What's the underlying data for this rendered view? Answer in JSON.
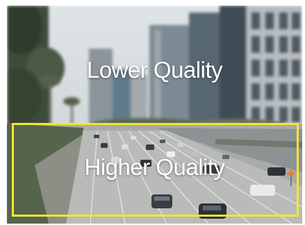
{
  "labels": {
    "top": "Lower Quality",
    "bottom": "Higher Quality"
  },
  "colors": {
    "highlight_border": "#f2e72b",
    "label_text": "#ffffff"
  }
}
